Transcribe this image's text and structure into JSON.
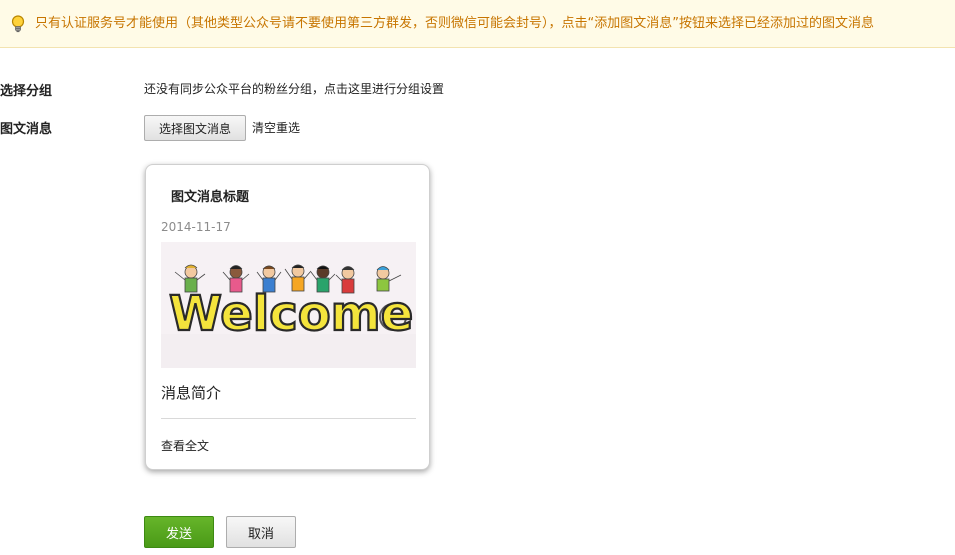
{
  "notice": {
    "icon": "lightbulb-icon",
    "text": "只有认证服务号才能使用（其他类型公众号请不要使用第三方群发，否则微信可能会封号），点击“添加图文消息”按钮来选择已经添加过的图文消息",
    "color": "#c77500",
    "background": "#fffbe7"
  },
  "form": {
    "group_label": "选择分组",
    "group_hint": "还没有同步公众平台的粉丝分组，点击这里进行分组设置",
    "news_label": "图文消息",
    "select_button": "选择图文消息",
    "clear_link": "清空重选"
  },
  "card": {
    "title": "图文消息标题",
    "date": "2014-11-17",
    "cover_text": "Welcome",
    "summary": "消息简介",
    "read_more": "查看全文"
  },
  "actions": {
    "send": "发送",
    "cancel": "取消",
    "send_color": "#55a61f"
  }
}
